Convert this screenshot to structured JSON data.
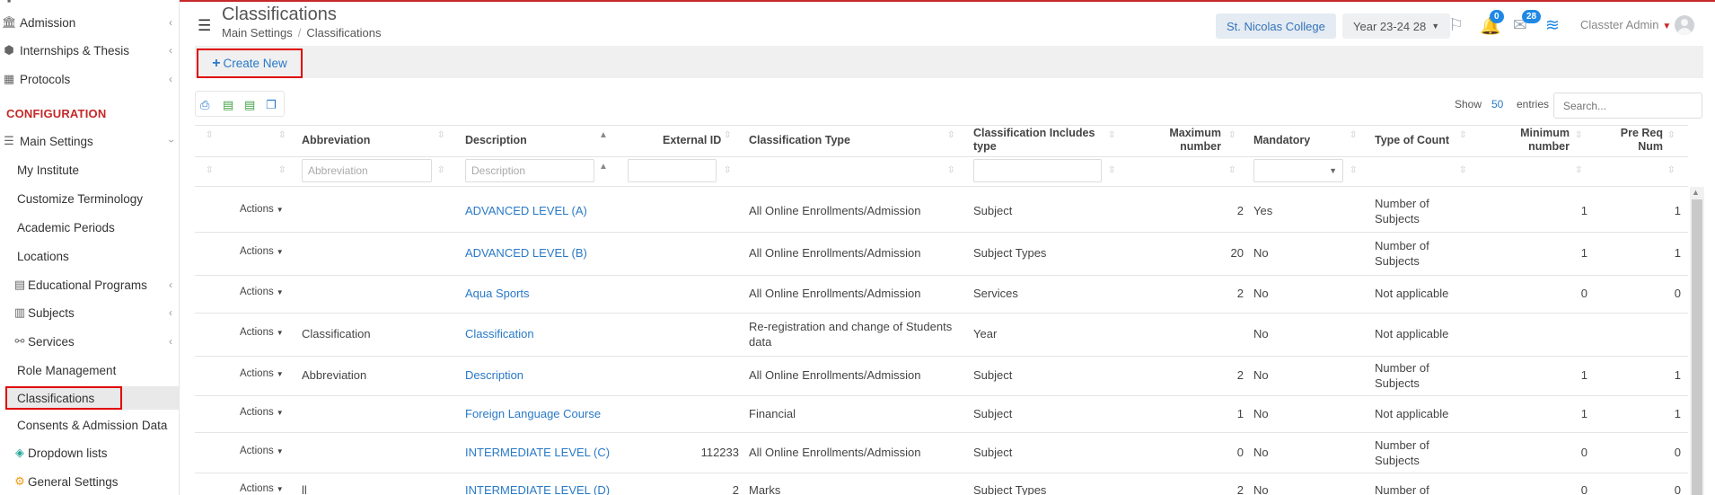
{
  "sidebar": {
    "items": [
      {
        "label": "Admission",
        "icon": "bank-icon"
      },
      {
        "label": "Internships & Thesis",
        "icon": "cube-icon"
      },
      {
        "label": "Protocols",
        "icon": "calendar-icon"
      }
    ],
    "section": "CONFIGURATION",
    "main_settings": "Main Settings",
    "sub_items": [
      "My Institute",
      "Customize Terminology",
      "Academic Periods",
      "Locations",
      "Educational Programs",
      "Subjects",
      "Services",
      "Role Management",
      "Classifications",
      "Consents & Admission Data",
      "Dropdown lists",
      "General Settings"
    ]
  },
  "header": {
    "title": "Classifications",
    "breadcrumb": [
      "Main Settings",
      "Classifications"
    ],
    "college": "St. Nicolas College",
    "year": "Year 23-24 28",
    "notifications_count": "0",
    "messages_count": "28",
    "user": "Classter Admin"
  },
  "toolbar": {
    "create_label": "Create New"
  },
  "table_controls": {
    "show_label": "Show",
    "show_value": "50",
    "entries_label": "entries",
    "search_placeholder": "Search..."
  },
  "table": {
    "headers": {
      "abbreviation": "Abbreviation",
      "description": "Description",
      "external_id": "External ID",
      "classification_type": "Classification Type",
      "includes_type_1": "Classification Includes",
      "includes_type_2": "type",
      "max_1": "Maximum",
      "max_2": "number",
      "mandatory": "Mandatory",
      "type_of_count": "Type of Count",
      "min_1": "Minimum",
      "min_2": "number",
      "prereq_1": "Pre Req",
      "prereq_2": "Num"
    },
    "filters": {
      "abbreviation_placeholder": "Abbreviation",
      "description_placeholder": "Description"
    },
    "actions_label": "Actions",
    "rows": [
      {
        "abbr": "",
        "desc": "ADVANCED LEVEL (A)",
        "ext": "",
        "type": "All Online Enrollments/Admission",
        "type2": "",
        "incl": "Subject",
        "max": "2",
        "mand": "Yes",
        "count": "Number of",
        "count2": "Subjects",
        "min": "1",
        "pre": "1"
      },
      {
        "abbr": "",
        "desc": "ADVANCED LEVEL (B)",
        "ext": "",
        "type": "All Online Enrollments/Admission",
        "type2": "",
        "incl": "Subject Types",
        "max": "20",
        "mand": "No",
        "count": "Number of",
        "count2": "Subjects",
        "min": "1",
        "pre": "1"
      },
      {
        "abbr": "",
        "desc": "Aqua Sports",
        "ext": "",
        "type": "All Online Enrollments/Admission",
        "type2": "",
        "incl": "Services",
        "max": "2",
        "mand": "No",
        "count": "Not applicable",
        "count2": "",
        "min": "0",
        "pre": "0"
      },
      {
        "abbr": "Classification",
        "desc": "Classification",
        "ext": "",
        "type": "Re-registration and change of Students",
        "type2": "data",
        "incl": "Year",
        "max": "",
        "mand": "No",
        "count": "Not applicable",
        "count2": "",
        "min": "",
        "pre": ""
      },
      {
        "abbr": "Abbreviation",
        "desc": "Description",
        "ext": "",
        "type": "All Online Enrollments/Admission",
        "type2": "",
        "incl": "Subject",
        "max": "2",
        "mand": "No",
        "count": "Number of",
        "count2": "Subjects",
        "min": "1",
        "pre": "1"
      },
      {
        "abbr": "",
        "desc": "Foreign Language Course",
        "ext": "",
        "type": "Financial",
        "type2": "",
        "incl": "Subject",
        "max": "1",
        "mand": "No",
        "count": "Not applicable",
        "count2": "",
        "min": "1",
        "pre": "1"
      },
      {
        "abbr": "",
        "desc": "INTERMEDIATE LEVEL (C)",
        "ext": "112233",
        "type": "All Online Enrollments/Admission",
        "type2": "",
        "incl": "Subject",
        "max": "0",
        "mand": "No",
        "count": "Number of",
        "count2": "Subjects",
        "min": "0",
        "pre": "0"
      },
      {
        "abbr": "ll",
        "desc": "INTERMEDIATE LEVEL (D)",
        "ext": "2",
        "type": "Marks",
        "type2": "",
        "incl": "Subject Types",
        "max": "2",
        "mand": "No",
        "count": "Number of",
        "count2": "",
        "min": "0",
        "pre": "0"
      }
    ]
  }
}
